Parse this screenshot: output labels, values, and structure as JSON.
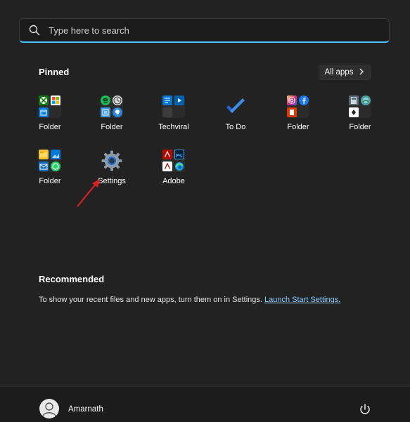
{
  "search": {
    "placeholder": "Type here to search"
  },
  "pinned": {
    "title": "Pinned",
    "all_apps_label": "All apps",
    "tiles": [
      {
        "label": "Folder"
      },
      {
        "label": "Folder"
      },
      {
        "label": "Techviral"
      },
      {
        "label": "To Do"
      },
      {
        "label": "Folder"
      },
      {
        "label": "Folder"
      },
      {
        "label": "Folder"
      },
      {
        "label": "Settings"
      },
      {
        "label": "Adobe"
      }
    ]
  },
  "recommended": {
    "title": "Recommended",
    "text": "To show your recent files and new apps, turn them on in Settings.",
    "link": "Launch Start Settings."
  },
  "user": {
    "name": "Amarnath"
  },
  "icons": {
    "search": "search-icon",
    "chevron": "chevron-right-icon",
    "power": "power-icon",
    "avatar": "user-avatar-icon",
    "settings": "gear-icon"
  },
  "colors": {
    "accent": "#4cc2ff",
    "link": "#8cd0ff",
    "annotation_arrow": "#e02020"
  }
}
